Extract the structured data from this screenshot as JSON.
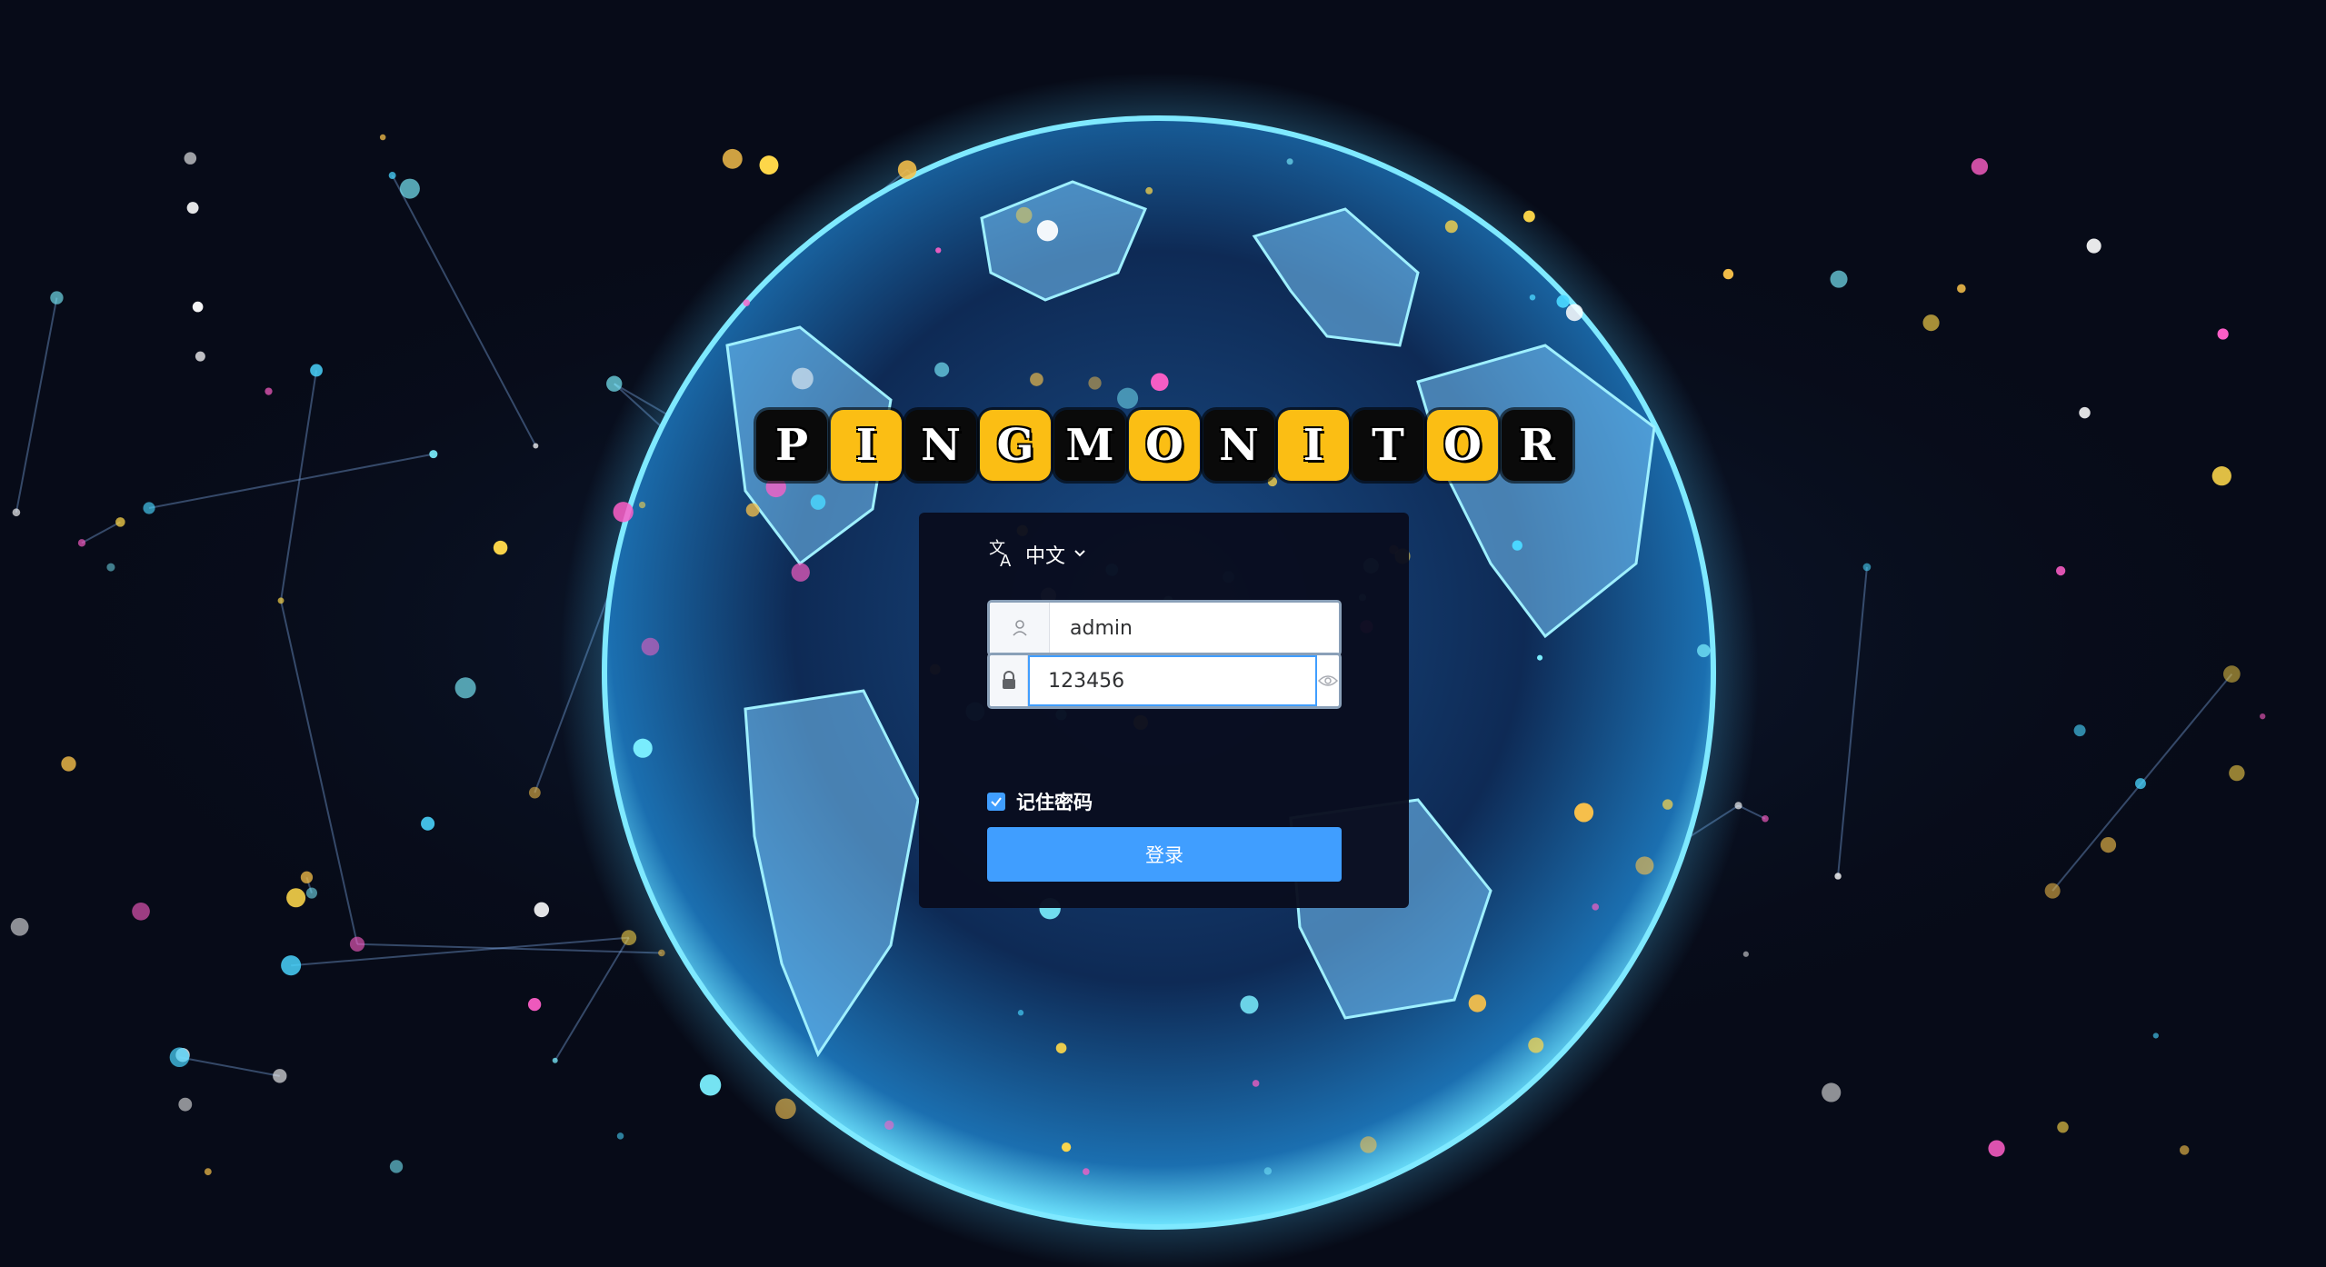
{
  "logo": {
    "letters": [
      "P",
      "I",
      "N",
      "G",
      "M",
      "O",
      "N",
      "I",
      "T",
      "O",
      "R"
    ],
    "tile_colors": [
      "dark",
      "yellow",
      "dark",
      "yellow",
      "dark",
      "yellow",
      "dark",
      "yellow",
      "dark",
      "yellow",
      "dark"
    ]
  },
  "language": {
    "label": "中文",
    "icon": "translate-icon"
  },
  "username": {
    "value": "admin",
    "icon": "user-icon"
  },
  "password": {
    "value": "123456",
    "icon": "lock-icon",
    "toggle_icon": "eye-icon"
  },
  "remember": {
    "label": "记住密码",
    "checked": true
  },
  "login_button": {
    "label": "登录"
  },
  "colors": {
    "accent": "#409eff",
    "tile_yellow": "#fbbe14",
    "tile_dark": "#0a0a0a",
    "card": "#090c1e",
    "background": "#070b18"
  }
}
